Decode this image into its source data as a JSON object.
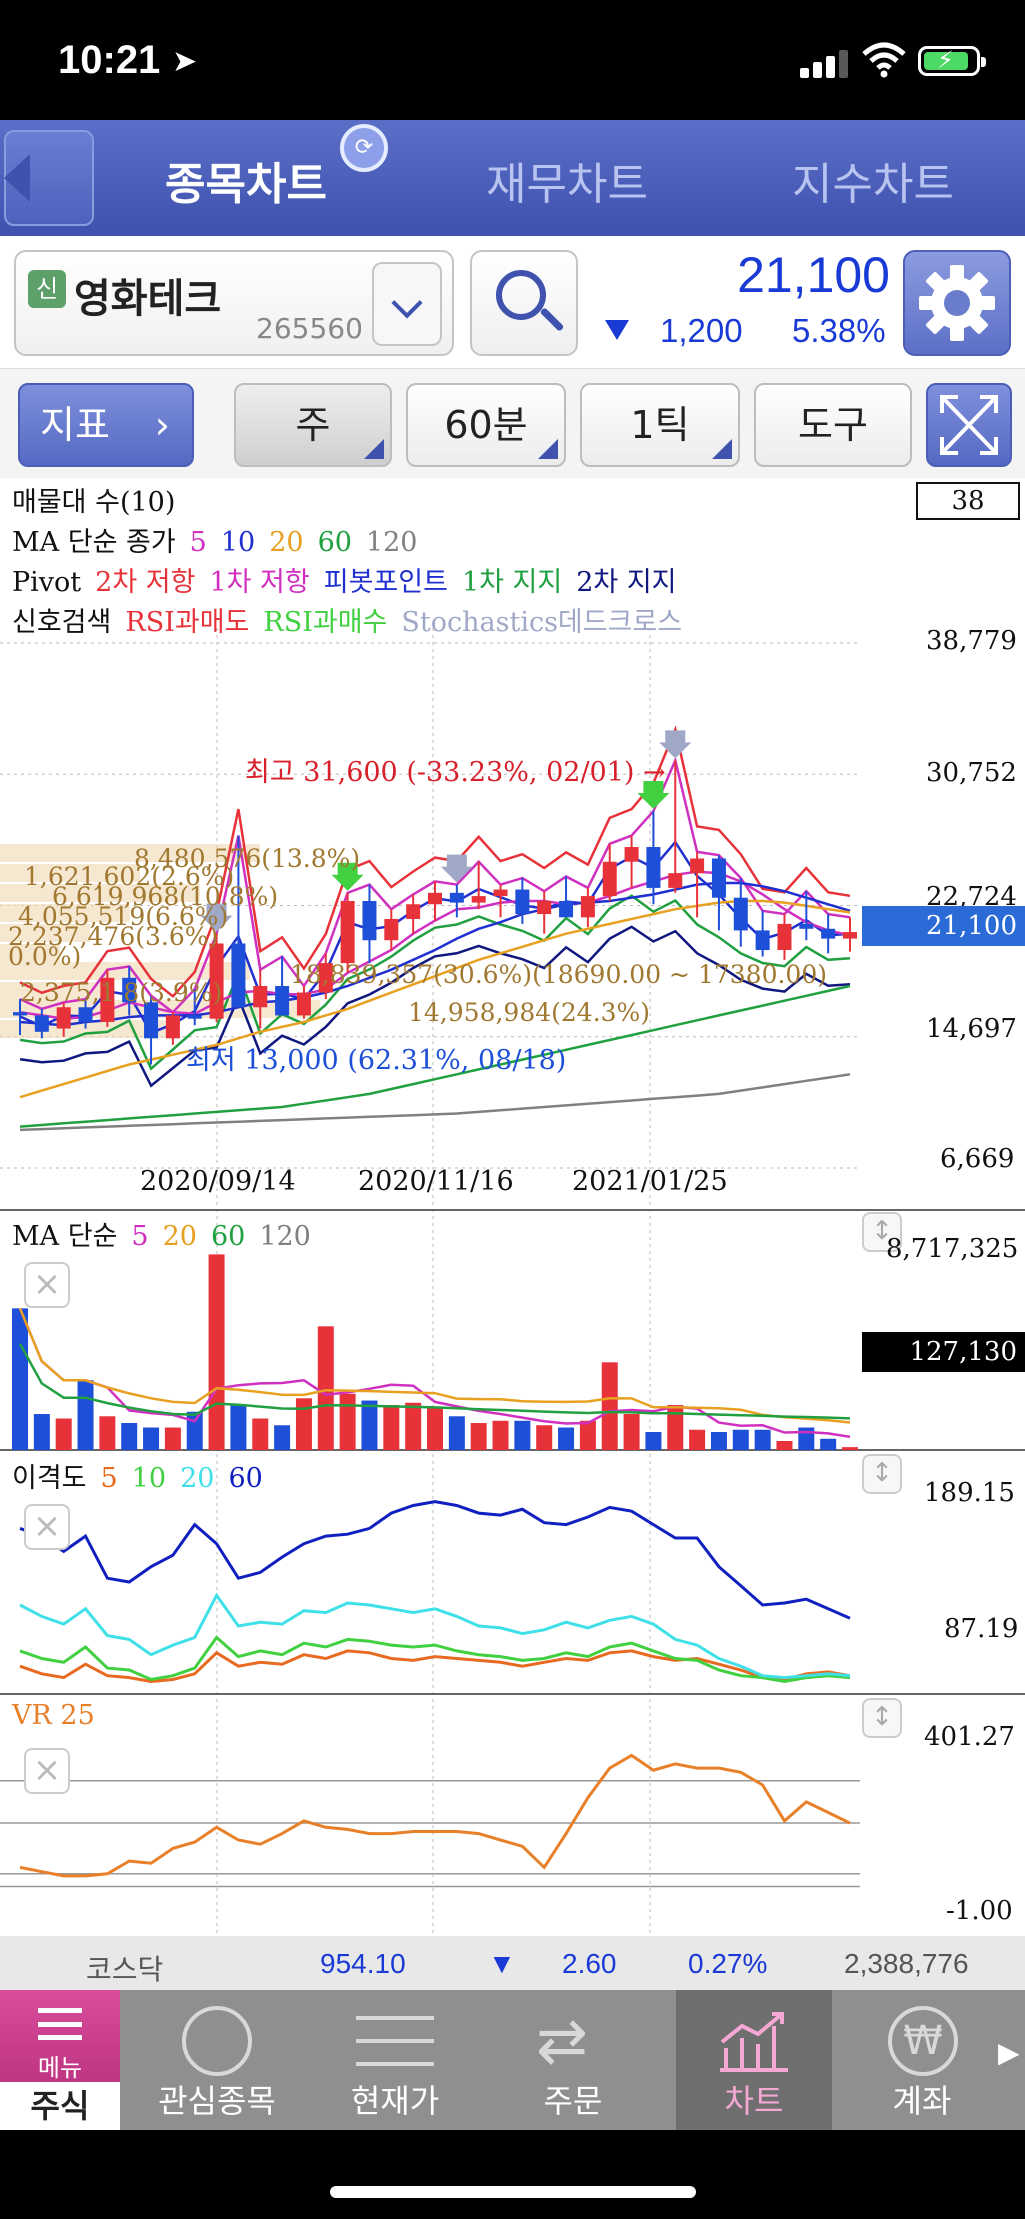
{
  "status": {
    "time": "10:21"
  },
  "nav": {
    "tabs": [
      "종목차트",
      "재무차트",
      "지수차트"
    ]
  },
  "stock": {
    "tag": "신",
    "name": "영화테크",
    "code": "265560",
    "price": "21,100",
    "change": "1,200",
    "change_pct": "5.38%"
  },
  "toolbar": {
    "indicator": "지표",
    "period": "주",
    "minute": "60분",
    "tick": "1틱",
    "tools": "도구"
  },
  "main_chart": {
    "legend_line1": "매물대 수(10)",
    "legend_line2": {
      "label": "MA 단순 종가",
      "items": [
        "5",
        "10",
        "20",
        "60",
        "120"
      ]
    },
    "legend_line3": {
      "label": "Pivot",
      "items": [
        "2차 저항",
        "1차 저항",
        "피봇포인트",
        "1차 지지",
        "2차 지지"
      ]
    },
    "legend_line4": {
      "label": "신호검색",
      "items": [
        "RSI과매도",
        "RSI과매수",
        "Stochastics데드크로스"
      ]
    },
    "count_box": "38",
    "y_labels": [
      "38,779",
      "30,752",
      "22,724",
      "14,697",
      "6,669"
    ],
    "current_price_label": "21,100",
    "dates": [
      "2020/09/14",
      "2020/11/16",
      "2021/01/25"
    ],
    "annot_high": "최고 31,600 (-33.23%, 02/01) →",
    "annot_low": "최저 13,000 (62.31%, 08/18)",
    "volume_profile_labels": [
      "8,480,576(13.8%)",
      "1,621,602(2.6%)",
      "6,619,968(10.8%)",
      "4,055,519(6.6%)",
      "2,237,476(3.6%)",
      "0.0%)",
      "2,375,1 8(3.9%)",
      "18,839,357(30.6%)(18690.00 ~ 17380.00)",
      "14,958,984(24.3%)"
    ]
  },
  "volume_panel": {
    "label": "MA 단순",
    "items": [
      "5",
      "20",
      "60",
      "120"
    ],
    "y_top": "8,717,325",
    "current": "127,130"
  },
  "disparity_panel": {
    "label": "이격도",
    "items": [
      "5",
      "10",
      "20",
      "60"
    ],
    "y_top": "189.15",
    "y_bottom": "87.19"
  },
  "vr_panel": {
    "label": "VR 25",
    "y_top": "401.27",
    "y_bottom": "-1.00"
  },
  "market": {
    "name": "코스닥",
    "index": "954.10",
    "change": "2.60",
    "pct": "0.27%",
    "volume": "2,388,776"
  },
  "bottom_nav": {
    "menu_top": "메뉴",
    "items": [
      "주식",
      "관심종목",
      "현재가",
      "주문",
      "차트",
      "계좌"
    ]
  },
  "colors": {
    "up": "#e8323a",
    "down": "#1e4fd8",
    "ma5": "#d030c0",
    "ma10": "#2030d0",
    "ma20": "#e8a020",
    "ma60": "#20a040",
    "ma120": "#808080",
    "accent": "#3e52ae"
  },
  "chart_data": [
    {
      "type": "candlestick",
      "title": "",
      "x_ticks": [
        "2020/09/14",
        "2020/11/16",
        "2021/01/25"
      ],
      "ylim": [
        6669,
        38779
      ],
      "y_ticks": [
        38779,
        30752,
        22724,
        14697,
        6669
      ],
      "candles": [
        [
          16200,
          17000,
          14800,
          16000
        ],
        [
          16000,
          16400,
          14600,
          15000
        ],
        [
          15200,
          16800,
          14700,
          16500
        ],
        [
          16500,
          17000,
          15200,
          15600
        ],
        [
          15600,
          18800,
          15300,
          18300
        ],
        [
          18300,
          19000,
          16000,
          16800
        ],
        [
          16800,
          17200,
          13000,
          14600
        ],
        [
          14600,
          16200,
          14200,
          16000
        ],
        [
          16000,
          17600,
          15400,
          15800
        ],
        [
          15800,
          21000,
          15600,
          20400
        ],
        [
          20400,
          27000,
          19000,
          16500
        ],
        [
          16500,
          18800,
          15200,
          17800
        ],
        [
          17800,
          19600,
          16400,
          16000
        ],
        [
          16000,
          17800,
          15800,
          17400
        ],
        [
          17400,
          19800,
          17000,
          19200
        ],
        [
          19200,
          23500,
          18600,
          23000
        ],
        [
          23000,
          24000,
          19200,
          20600
        ],
        [
          20600,
          22500,
          20000,
          21900
        ],
        [
          21900,
          23400,
          21000,
          22800
        ],
        [
          22800,
          24200,
          21800,
          23500
        ],
        [
          23500,
          24000,
          22000,
          22900
        ],
        [
          22900,
          25400,
          22500,
          23300
        ],
        [
          23300,
          24000,
          22000,
          23700
        ],
        [
          23700,
          24400,
          21600,
          22200
        ],
        [
          22200,
          23600,
          21000,
          23000
        ],
        [
          23000,
          24500,
          22400,
          22000
        ],
        [
          22000,
          23800,
          21400,
          23300
        ],
        [
          23300,
          26500,
          23000,
          25400
        ],
        [
          25400,
          27000,
          23800,
          26300
        ],
        [
          26300,
          28500,
          22800,
          23800
        ],
        [
          23800,
          31600,
          23500,
          24700
        ],
        [
          24700,
          26000,
          22000,
          25600
        ],
        [
          25600,
          25800,
          21200,
          23200
        ],
        [
          23200,
          24400,
          20200,
          21200
        ],
        [
          21200,
          22400,
          19600,
          20000
        ],
        [
          20000,
          22200,
          19400,
          21600
        ],
        [
          21600,
          23600,
          20600,
          21300
        ],
        [
          21300,
          22200,
          19800,
          20700
        ],
        [
          20700,
          22000,
          19900,
          21100
        ]
      ],
      "series": [
        {
          "name": "5",
          "values": [
            16200,
            16000,
            15800,
            15900,
            16300,
            16800,
            16500,
            16200,
            16100,
            16800,
            17400,
            17500,
            17300,
            17300,
            17600,
            18600,
            19300,
            20000,
            21000,
            21800,
            22500,
            22600,
            22900,
            23000,
            23000,
            22800,
            22900,
            23300,
            23800,
            24200,
            24600,
            24800,
            24700,
            24200,
            23400,
            22500,
            21700,
            21200,
            20900
          ]
        },
        {
          "name": "10",
          "values": [
            15600,
            15500,
            15400,
            15600,
            15700,
            15900,
            16000,
            16000,
            16000,
            16200,
            16500,
            16800,
            16900,
            17100,
            17400,
            17800,
            18300,
            18800,
            19400,
            20000,
            20700,
            21300,
            21700,
            22200,
            22500,
            22800,
            22900,
            23000,
            23200,
            23400,
            23700,
            24000,
            24100,
            24100,
            23900,
            23600,
            23200,
            22800,
            22400
          ]
        },
        {
          "name": "20",
          "values": [
            11000,
            11400,
            11800,
            12200,
            12600,
            13000,
            13300,
            13600,
            13900,
            14200,
            14600,
            15000,
            15300,
            15600,
            16000,
            16400,
            16900,
            17400,
            17900,
            18400,
            18900,
            19400,
            19800,
            20200,
            20600,
            21000,
            21300,
            21600,
            21900,
            22200,
            22500,
            22700,
            22900,
            23000,
            23000,
            22900,
            22700,
            22500,
            22300
          ]
        },
        {
          "name": "60",
          "values": [
            9200,
            9300,
            9400,
            9500,
            9600,
            9700,
            9800,
            9900,
            10000,
            10100,
            10200,
            10300,
            10400,
            10600,
            10800,
            11000,
            11200,
            11500,
            11800,
            12100,
            12400,
            12700,
            13000,
            13300,
            13600,
            13900,
            14200,
            14500,
            14800,
            15100,
            15400,
            15700,
            16000,
            16300,
            16600,
            16900,
            17200,
            17500,
            17800
          ]
        },
        {
          "name": "120",
          "values": [
            9000,
            9050,
            9100,
            9150,
            9200,
            9250,
            9300,
            9350,
            9400,
            9450,
            9500,
            9550,
            9600,
            9650,
            9700,
            9750,
            9800,
            9850,
            9900,
            9950,
            10000,
            10100,
            10200,
            10300,
            10400,
            10500,
            10600,
            10700,
            10800,
            10900,
            11000,
            11100,
            11200,
            11400,
            11600,
            11800,
            12000,
            12200,
            12400
          ]
        }
      ]
    },
    {
      "type": "bar",
      "title": "MA 단순",
      "ylim": [
        0,
        8717325
      ],
      "values": [
        6300000,
        1600000,
        1400000,
        3100000,
        1500000,
        1200000,
        1000000,
        1000000,
        1700000,
        8700000,
        2000000,
        1400000,
        1100000,
        2300000,
        5500000,
        2500000,
        2200000,
        2000000,
        2100000,
        1900000,
        1500000,
        1200000,
        1300000,
        1300000,
        1100000,
        1000000,
        1300000,
        3900000,
        1600000,
        800000,
        2000000,
        900000,
        800000,
        900000,
        900000,
        400000,
        1000000,
        500000,
        127130
      ]
    },
    {
      "type": "line",
      "title": "이격도",
      "ylim": [
        87.19,
        189.15
      ],
      "series": [
        {
          "name": "5",
          "values": [
            96,
            92,
            90,
            97,
            91,
            90,
            88,
            89,
            92,
            103,
            96,
            98,
            97,
            102,
            100,
            104,
            103,
            100,
            99,
            101,
            100,
            99,
            98,
            96,
            98,
            100,
            99,
            103,
            104,
            101,
            99,
            100,
            97,
            94,
            90,
            89,
            92,
            93,
            91
          ]
        },
        {
          "name": "10",
          "values": [
            104,
            100,
            98,
            106,
            95,
            94,
            89,
            91,
            95,
            111,
            101,
            104,
            102,
            108,
            106,
            110,
            109,
            107,
            106,
            107,
            104,
            102,
            101,
            99,
            100,
            103,
            101,
            106,
            108,
            104,
            100,
            99,
            94,
            91,
            90,
            88,
            90,
            91,
            90
          ]
        },
        {
          "name": "20",
          "values": [
            128,
            122,
            118,
            126,
            112,
            110,
            102,
            107,
            111,
            133,
            117,
            119,
            118,
            125,
            124,
            129,
            128,
            126,
            124,
            126,
            122,
            117,
            116,
            113,
            115,
            119,
            116,
            120,
            122,
            118,
            110,
            107,
            100,
            96,
            91,
            90,
            91,
            92,
            91
          ]
        },
        {
          "name": "60",
          "values": [
            168,
            164,
            156,
            164,
            142,
            140,
            148,
            154,
            170,
            160,
            142,
            145,
            153,
            160,
            164,
            165,
            168,
            176,
            180,
            182,
            180,
            176,
            175,
            178,
            171,
            170,
            174,
            179,
            177,
            170,
            163,
            163,
            148,
            138,
            128,
            129,
            131,
            126,
            121
          ]
        }
      ]
    },
    {
      "type": "line",
      "title": "VR 25",
      "ylim": [
        -1.0,
        401.27
      ],
      "series": [
        {
          "name": "VR",
          "values": [
            95,
            85,
            75,
            75,
            80,
            110,
            105,
            140,
            155,
            190,
            160,
            150,
            175,
            205,
            190,
            185,
            175,
            175,
            180,
            180,
            180,
            175,
            160,
            145,
            95,
            175,
            260,
            330,
            360,
            325,
            340,
            330,
            330,
            320,
            290,
            205,
            250,
            225,
            200
          ]
        }
      ]
    }
  ]
}
